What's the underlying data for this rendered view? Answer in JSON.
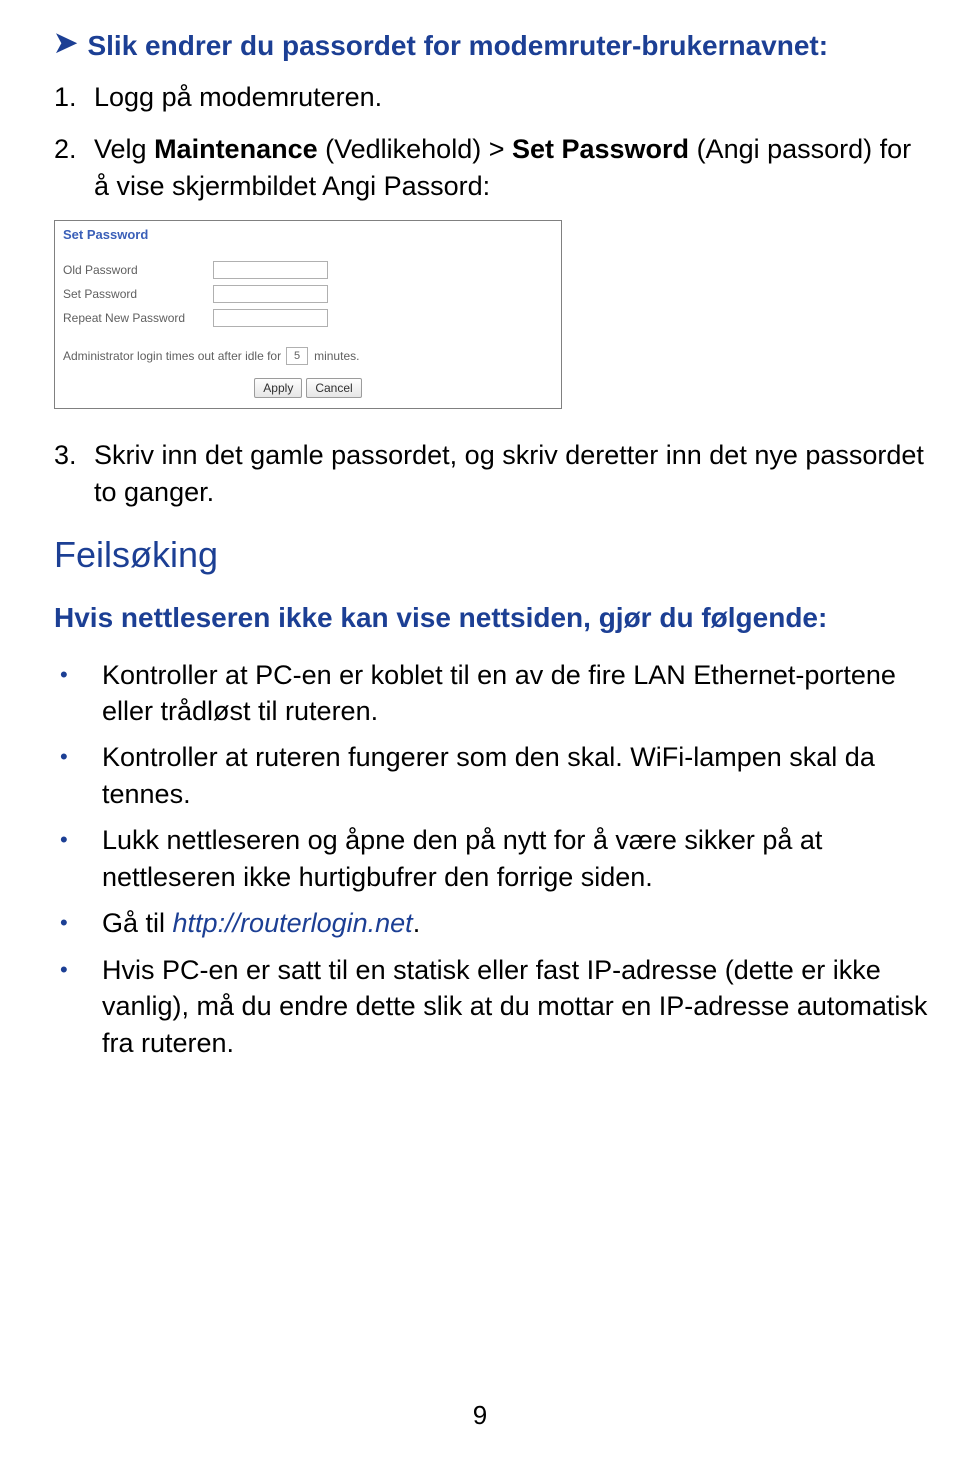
{
  "heading": "Slik endrer du passordet for modemruter-brukernavnet:",
  "steps": {
    "s1": "Logg på modemruteren.",
    "s2_pre": "Velg ",
    "s2_b1": "Maintenance",
    "s2_m1": " (Vedlikehold) > ",
    "s2_b2": "Set Password",
    "s2_m2": " (Angi passord) for å vise skjermbildet Angi Passord:",
    "s3": "Skriv inn det gamle passordet, og skriv deretter inn det nye passordet to ganger."
  },
  "screenshot": {
    "title": "Set Password",
    "old_pw": "Old Password",
    "set_pw": "Set Password",
    "repeat_pw": "Repeat New Password",
    "admin_prefix": "Administrator login times out after idle for",
    "timeout_value": "5",
    "admin_suffix": "minutes.",
    "apply": "Apply",
    "cancel": "Cancel"
  },
  "troubleshoot": {
    "title": "Feilsøking",
    "intro": "Hvis nettleseren ikke kan vise nettsiden, gjør du følgende:",
    "b1": "Kontroller at PC-en er koblet til en av de fire LAN Ethernet-portene eller trådløst til ruteren.",
    "b2": "Kontroller at ruteren fungerer som den skal. WiFi-lampen skal da tennes.",
    "b3": "Lukk nettleseren og åpne den på nytt for å være sikker på at nettleseren ikke hurtigbufrer den forrige siden.",
    "b4_pre": "Gå til ",
    "b4_link": "http://routerlogin.net",
    "b4_post": ".",
    "b5": "Hvis PC-en er satt til en statisk eller fast IP-adresse (dette er ikke vanlig), må du endre dette slik at du mottar en IP-adresse automatisk fra ruteren."
  },
  "page_number": "9"
}
